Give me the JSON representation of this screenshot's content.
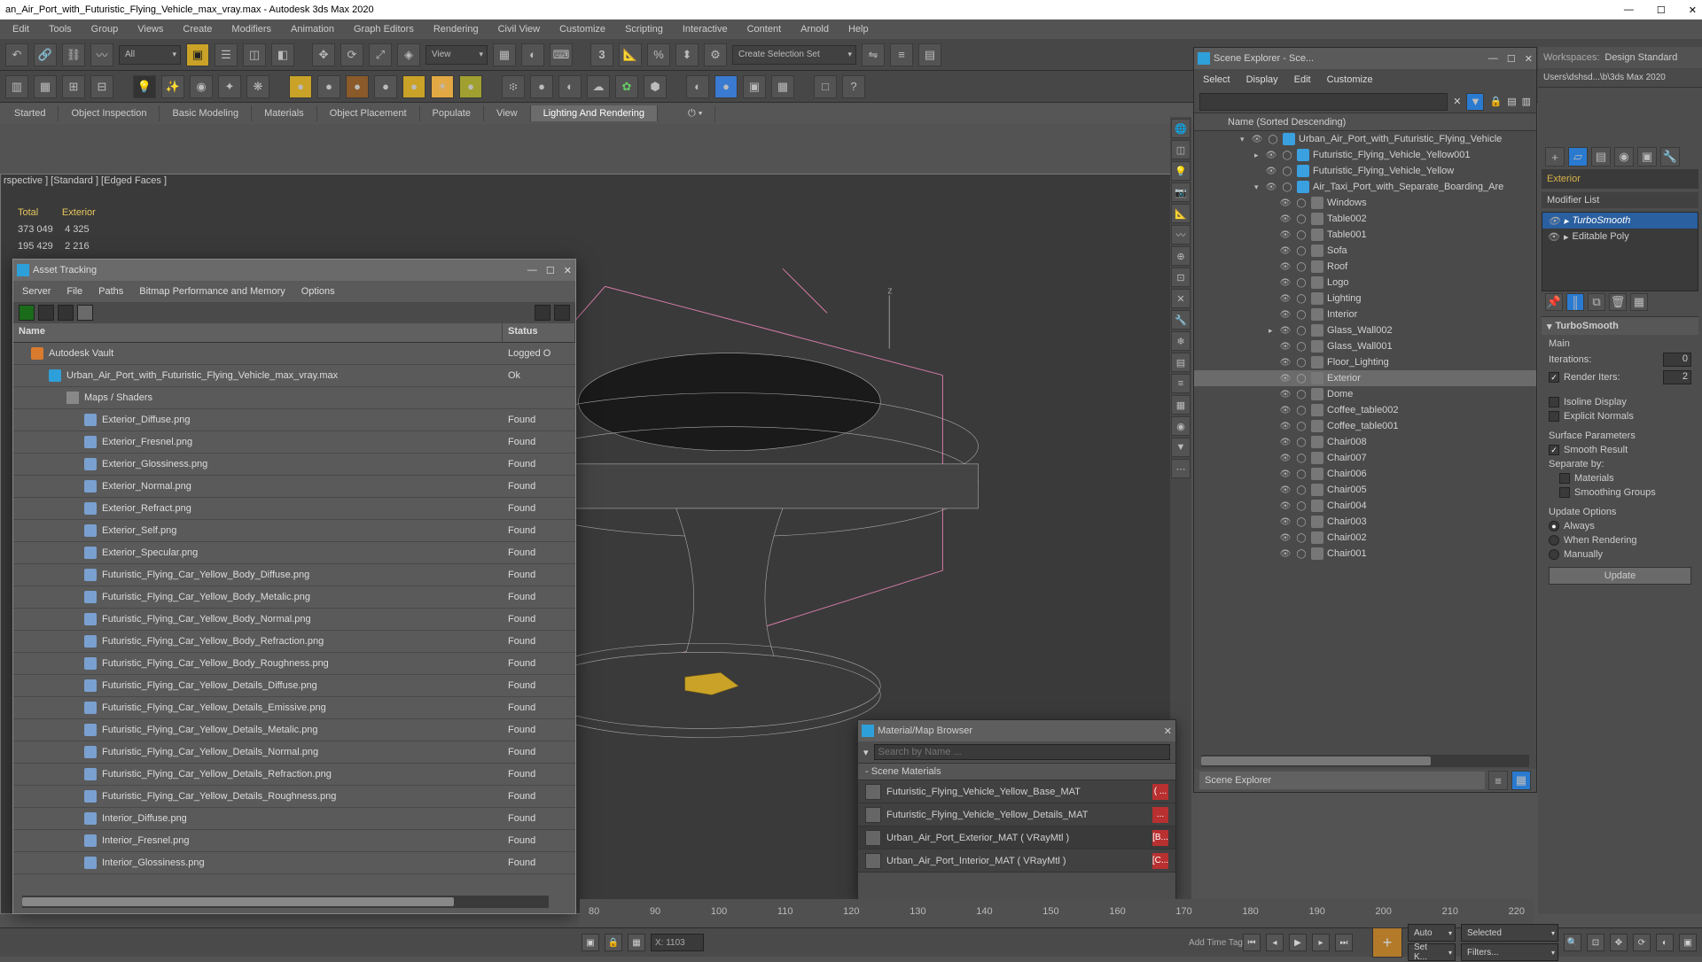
{
  "title": "an_Air_Port_with_Futuristic_Flying_Vehicle_max_vray.max - Autodesk 3ds Max 2020",
  "menus": [
    "Edit",
    "Tools",
    "Group",
    "Views",
    "Create",
    "Modifiers",
    "Animation",
    "Graph Editors",
    "Rendering",
    "Civil View",
    "Customize",
    "Scripting",
    "Interactive",
    "Content",
    "Arnold",
    "Help"
  ],
  "tb1": {
    "filter": "All",
    "view": "View",
    "selset": "Create Selection Set"
  },
  "tabs": [
    "Started",
    "Object Inspection",
    "Basic Modeling",
    "Materials",
    "Object Placement",
    "Populate",
    "View",
    "Lighting And Rendering"
  ],
  "active_tab": 7,
  "viewlabel": "rspective ] [Standard ] [Edged Faces ]",
  "stats": {
    "h1": "Total",
    "h2": "Exterior",
    "r1a": "373 049",
    "r1b": "4 325",
    "r2a": "195 429",
    "r2b": "2 216"
  },
  "scene_explorer": {
    "title": "Scene Explorer - Sce...",
    "menus": [
      "Select",
      "Display",
      "Edit",
      "Customize"
    ],
    "colhdr": "Name (Sorted Descending)",
    "rows": [
      {
        "d": 0,
        "exp": "▾",
        "ico": "blue",
        "n": "Urban_Air_Port_with_Futuristic_Flying_Vehicle"
      },
      {
        "d": 1,
        "exp": "▸",
        "ico": "blue",
        "n": "Futuristic_Flying_Vehicle_Yellow001"
      },
      {
        "d": 1,
        "exp": "",
        "ico": "blue",
        "n": "Futuristic_Flying_Vehicle_Yellow"
      },
      {
        "d": 1,
        "exp": "▾",
        "ico": "blue",
        "n": "Air_Taxi_Port_with_Separate_Boarding_Are"
      },
      {
        "d": 2,
        "exp": "",
        "ico": "",
        "n": "Windows"
      },
      {
        "d": 2,
        "exp": "",
        "ico": "",
        "n": "Table002"
      },
      {
        "d": 2,
        "exp": "",
        "ico": "",
        "n": "Table001"
      },
      {
        "d": 2,
        "exp": "",
        "ico": "",
        "n": "Sofa"
      },
      {
        "d": 2,
        "exp": "",
        "ico": "",
        "n": "Roof"
      },
      {
        "d": 2,
        "exp": "",
        "ico": "",
        "n": "Logo"
      },
      {
        "d": 2,
        "exp": "",
        "ico": "",
        "n": "Lighting"
      },
      {
        "d": 2,
        "exp": "",
        "ico": "",
        "n": "Interior"
      },
      {
        "d": 2,
        "exp": "▸",
        "ico": "",
        "n": "Glass_Wall002"
      },
      {
        "d": 2,
        "exp": "",
        "ico": "",
        "n": "Glass_Wall001"
      },
      {
        "d": 2,
        "exp": "",
        "ico": "",
        "n": "Floor_Lighting"
      },
      {
        "d": 2,
        "exp": "",
        "ico": "",
        "n": "Exterior",
        "sel": true
      },
      {
        "d": 2,
        "exp": "",
        "ico": "",
        "n": "Dome"
      },
      {
        "d": 2,
        "exp": "",
        "ico": "",
        "n": "Coffee_table002"
      },
      {
        "d": 2,
        "exp": "",
        "ico": "",
        "n": "Coffee_table001"
      },
      {
        "d": 2,
        "exp": "",
        "ico": "",
        "n": "Chair008"
      },
      {
        "d": 2,
        "exp": "",
        "ico": "",
        "n": "Chair007"
      },
      {
        "d": 2,
        "exp": "",
        "ico": "",
        "n": "Chair006"
      },
      {
        "d": 2,
        "exp": "",
        "ico": "",
        "n": "Chair005"
      },
      {
        "d": 2,
        "exp": "",
        "ico": "",
        "n": "Chair004"
      },
      {
        "d": 2,
        "exp": "",
        "ico": "",
        "n": "Chair003"
      },
      {
        "d": 2,
        "exp": "",
        "ico": "",
        "n": "Chair002"
      },
      {
        "d": 2,
        "exp": "",
        "ico": "",
        "n": "Chair001"
      }
    ],
    "footer": "Scene Explorer"
  },
  "cmd": {
    "ws_label": "Workspaces:",
    "ws_value": "Design Standard",
    "path": "Users\\dshsd...\\b\\3ds Max 2020",
    "objname": "Exterior",
    "modlist": "Modifier List",
    "stack": [
      {
        "n": "TurboSmooth",
        "sel": true,
        "exp": "▸"
      },
      {
        "n": "Editable Poly",
        "exp": "▸"
      }
    ],
    "rollout_title": "TurboSmooth",
    "main": "Main",
    "iter_lbl": "Iterations:",
    "iter_v": "0",
    "rend_lbl": "Render Iters:",
    "rend_v": "2",
    "rend_chk": true,
    "iso": "Isoline Display",
    "iso_chk": false,
    "expn": "Explicit Normals",
    "expn_chk": false,
    "surf": "Surface Parameters",
    "smooth": "Smooth Result",
    "smooth_chk": true,
    "sep": "Separate by:",
    "sep_mat": "Materials",
    "sep_sg": "Smoothing Groups",
    "updopt": "Update Options",
    "up_always": "Always",
    "up_rend": "When Rendering",
    "up_man": "Manually",
    "update": "Update"
  },
  "asset": {
    "title": "Asset Tracking",
    "menus": [
      "Server",
      "File",
      "Paths",
      "Bitmap Performance and Memory",
      "Options"
    ],
    "col_name": "Name",
    "col_status": "Status",
    "rows": [
      {
        "k": "vault",
        "ico": "v",
        "n": "Autodesk Vault",
        "s": "Logged O"
      },
      {
        "k": "max",
        "ico": "m",
        "ind": 1,
        "n": "Urban_Air_Port_with_Futuristic_Flying_Vehicle_max_vray.max",
        "s": "Ok"
      },
      {
        "k": "grp",
        "ind": 2,
        "n": "Maps / Shaders",
        "s": ""
      },
      {
        "k": "f",
        "ind": 3,
        "n": "Exterior_Diffuse.png",
        "s": "Found"
      },
      {
        "k": "f",
        "ind": 3,
        "n": "Exterior_Fresnel.png",
        "s": "Found"
      },
      {
        "k": "f",
        "ind": 3,
        "n": "Exterior_Glossiness.png",
        "s": "Found"
      },
      {
        "k": "f",
        "ind": 3,
        "n": "Exterior_Normal.png",
        "s": "Found"
      },
      {
        "k": "f",
        "ind": 3,
        "n": "Exterior_Refract.png",
        "s": "Found"
      },
      {
        "k": "f",
        "ind": 3,
        "n": "Exterior_Self.png",
        "s": "Found"
      },
      {
        "k": "f",
        "ind": 3,
        "n": "Exterior_Specular.png",
        "s": "Found"
      },
      {
        "k": "f",
        "ind": 3,
        "n": "Futuristic_Flying_Car_Yellow_Body_Diffuse.png",
        "s": "Found"
      },
      {
        "k": "f",
        "ind": 3,
        "n": "Futuristic_Flying_Car_Yellow_Body_Metalic.png",
        "s": "Found"
      },
      {
        "k": "f",
        "ind": 3,
        "n": "Futuristic_Flying_Car_Yellow_Body_Normal.png",
        "s": "Found"
      },
      {
        "k": "f",
        "ind": 3,
        "n": "Futuristic_Flying_Car_Yellow_Body_Refraction.png",
        "s": "Found"
      },
      {
        "k": "f",
        "ind": 3,
        "n": "Futuristic_Flying_Car_Yellow_Body_Roughness.png",
        "s": "Found"
      },
      {
        "k": "f",
        "ind": 3,
        "n": "Futuristic_Flying_Car_Yellow_Details_Diffuse.png",
        "s": "Found"
      },
      {
        "k": "f",
        "ind": 3,
        "n": "Futuristic_Flying_Car_Yellow_Details_Emissive.png",
        "s": "Found"
      },
      {
        "k": "f",
        "ind": 3,
        "n": "Futuristic_Flying_Car_Yellow_Details_Metalic.png",
        "s": "Found"
      },
      {
        "k": "f",
        "ind": 3,
        "n": "Futuristic_Flying_Car_Yellow_Details_Normal.png",
        "s": "Found"
      },
      {
        "k": "f",
        "ind": 3,
        "n": "Futuristic_Flying_Car_Yellow_Details_Refraction.png",
        "s": "Found"
      },
      {
        "k": "f",
        "ind": 3,
        "n": "Futuristic_Flying_Car_Yellow_Details_Roughness.png",
        "s": "Found"
      },
      {
        "k": "f",
        "ind": 3,
        "n": "Interior_Diffuse.png",
        "s": "Found"
      },
      {
        "k": "f",
        "ind": 3,
        "n": "Interior_Fresnel.png",
        "s": "Found"
      },
      {
        "k": "f",
        "ind": 3,
        "n": "Interior_Glossiness.png",
        "s": "Found"
      }
    ]
  },
  "material": {
    "title": "Material/Map Browser",
    "search_ph": "Search by Name ...",
    "group": "- Scene Materials",
    "items": [
      {
        "n": "Futuristic_Flying_Vehicle_Yellow_Base_MAT",
        "f": "( ..."
      },
      {
        "n": "Futuristic_Flying_Vehicle_Yellow_Details_MAT",
        "f": "..."
      },
      {
        "n": "Urban_Air_Port_Exterior_MAT  ( VRayMtl )",
        "f": "[B...",
        "sel": true
      },
      {
        "n": "Urban_Air_Port_Interior_MAT  ( VRayMtl )",
        "f": "[C..."
      }
    ]
  },
  "timeline": {
    "ticks": [
      "80",
      "90",
      "100",
      "110",
      "120",
      "130",
      "140",
      "150",
      "160",
      "170",
      "180",
      "190",
      "200",
      "210",
      "220"
    ]
  },
  "status": {
    "x": "X: 1103",
    "addtag": "Add Time Tag",
    "auto": "Auto",
    "selected": "Selected",
    "setk": "Set K...",
    "filters": "Filters..."
  }
}
